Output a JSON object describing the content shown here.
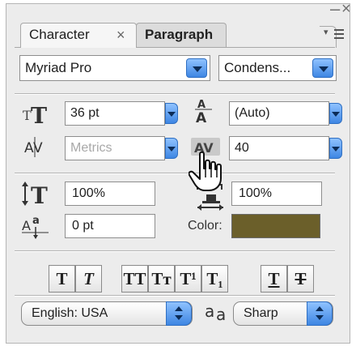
{
  "window": {
    "minimize_glyph": "–",
    "close_glyph": "×"
  },
  "tabs": [
    {
      "label": "Character",
      "close_glyph": "×",
      "active": true
    },
    {
      "label": "Paragraph",
      "active": false
    }
  ],
  "font": {
    "family": "Myriad Pro",
    "style": "Condens..."
  },
  "size": {
    "font_size": "36 pt",
    "leading": "(Auto)",
    "kerning": "Metrics",
    "tracking": "40"
  },
  "scale": {
    "vertical": "100%",
    "horizontal": "100%",
    "baseline_shift": "0 pt"
  },
  "color": {
    "label": "Color:",
    "value": "#6b5f2a"
  },
  "style_buttons": [
    {
      "name": "faux-bold",
      "label": "T"
    },
    {
      "name": "faux-italic",
      "label": "T"
    },
    {
      "name": "all-caps",
      "label": "TT"
    },
    {
      "name": "small-caps",
      "label": "Tт"
    },
    {
      "name": "superscript",
      "label": "T¹"
    },
    {
      "name": "subscript",
      "label": "T₁"
    },
    {
      "name": "underline",
      "label": "T"
    },
    {
      "name": "strikethrough",
      "label": "T"
    }
  ],
  "language": {
    "value": "English: USA"
  },
  "antialias": {
    "icon_text": "aa",
    "value": "Sharp"
  },
  "icons": {
    "font_size": "font-size-icon",
    "leading": "leading-icon",
    "kerning": "kerning-icon",
    "tracking": "tracking-icon",
    "vertical_scale": "vertical-scale-icon",
    "horizontal_scale": "horizontal-scale-icon",
    "baseline": "baseline-shift-icon",
    "cursor": "hand-cursor-icon"
  }
}
